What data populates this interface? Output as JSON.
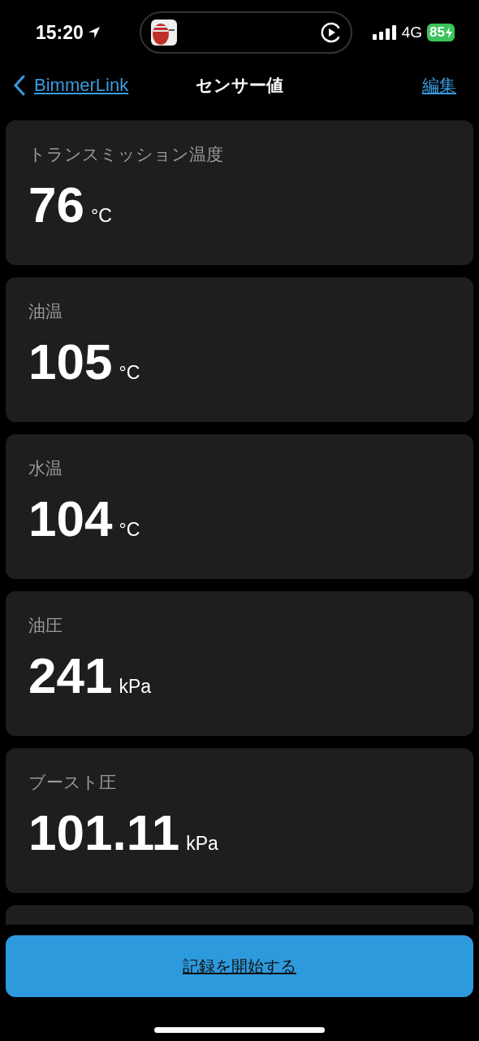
{
  "status_bar": {
    "time": "15:20",
    "network": "4G",
    "battery": "85"
  },
  "nav": {
    "back": "BimmerLink",
    "title": "センサー値",
    "edit": "編集"
  },
  "sensors": [
    {
      "label": "トランスミッション温度",
      "value": "76",
      "unit": "°C"
    },
    {
      "label": "油温",
      "value": "105",
      "unit": "°C"
    },
    {
      "label": "水温",
      "value": "104",
      "unit": "°C"
    },
    {
      "label": "油圧",
      "value": "241",
      "unit": "kPa"
    },
    {
      "label": "ブースト圧",
      "value": "101.11",
      "unit": "kPa"
    }
  ],
  "record_button": "記録を開始する"
}
